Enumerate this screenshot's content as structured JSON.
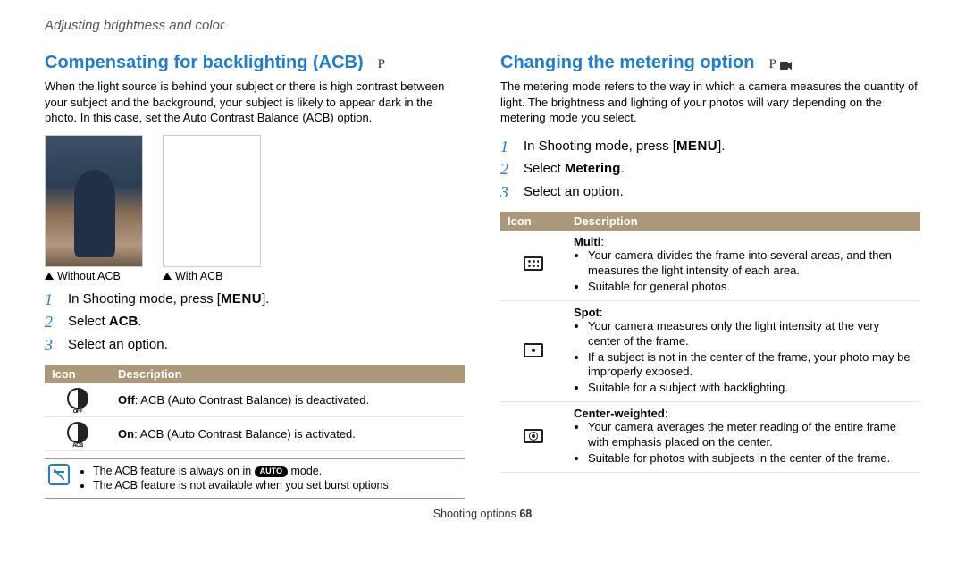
{
  "breadcrumb": "Adjusting brightness and color",
  "left": {
    "title": "Compensating for backlighting (ACB)",
    "mode": "P",
    "intro": "When the light source is behind your subject or there is high contrast between your subject and the background, your subject is likely to appear dark in the photo. In this case, set the Auto Contrast Balance (ACB) option.",
    "cap_without": "Without ACB",
    "cap_with": "With ACB",
    "step1_a": "In Shooting mode, press [",
    "menu_label": "MENU",
    "step1_b": "].",
    "step2_a": "Select ",
    "step2_b": "ACB",
    "step2_c": ".",
    "step3": "Select an option.",
    "th_icon": "Icon",
    "th_desc": "Description",
    "row_off_b": "Off",
    "row_off_t": ": ACB (Auto Contrast Balance) is deactivated.",
    "row_on_b": "On",
    "row_on_t": ": ACB (Auto Contrast Balance) is activated.",
    "note1_a": "The ACB feature is always on in ",
    "note1_auto": "AUTO",
    "note1_b": " mode.",
    "note2": "The ACB feature is not available when you set burst options."
  },
  "right": {
    "title": "Changing the metering option",
    "mode": "P",
    "intro": "The metering mode refers to the way in which a camera measures the quantity of light. The brightness and lighting of your photos will vary depending on the metering mode you select.",
    "step1_a": "In Shooting mode, press [",
    "menu_label": "MENU",
    "step1_b": "].",
    "step2_a": "Select ",
    "step2_b": "Metering",
    "step2_c": ".",
    "step3": "Select an option.",
    "th_icon": "Icon",
    "th_desc": "Description",
    "multi_title": "Multi",
    "multi_b1": "Your camera divides the frame into several areas, and then measures the light intensity of each area.",
    "multi_b2": "Suitable for general photos.",
    "spot_title": "Spot",
    "spot_b1": "Your camera measures only the light intensity at the very center of the frame.",
    "spot_b2": "If a subject is not in the center of the frame, your photo may be improperly exposed.",
    "spot_b3": "Suitable for a subject with backlighting.",
    "cw_title": "Center-weighted",
    "cw_b1": "Your camera averages the meter reading of the entire frame with emphasis placed on the center.",
    "cw_b2": "Suitable for photos with subjects in the center of the frame."
  },
  "footer_a": "Shooting options  ",
  "footer_b": "68"
}
